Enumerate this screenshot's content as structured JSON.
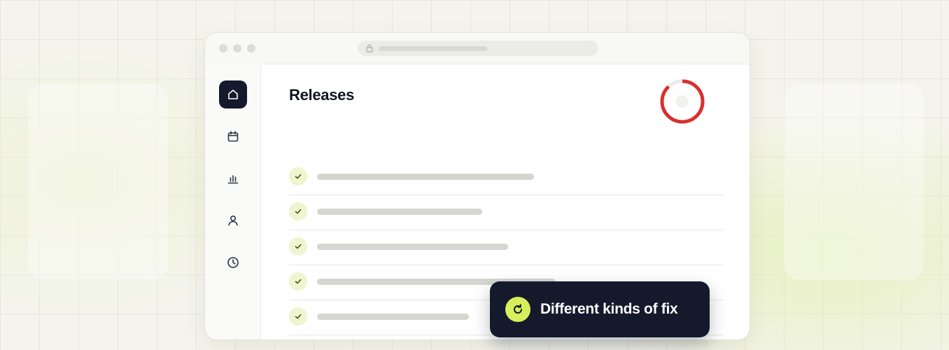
{
  "icons": {
    "lock": "lock-icon",
    "nav": [
      "home-icon",
      "calendar-icon",
      "chart-icon",
      "user-icon",
      "clock-icon"
    ],
    "row_status": "check-icon",
    "toast": "refresh-icon"
  },
  "sidebar": {
    "items": [
      {
        "icon": "home-icon",
        "active": true
      },
      {
        "icon": "calendar-icon",
        "active": false
      },
      {
        "icon": "chart-icon",
        "active": false
      },
      {
        "icon": "user-icon",
        "active": false
      },
      {
        "icon": "clock-icon",
        "active": false
      }
    ]
  },
  "main": {
    "title": "Releases",
    "progress": {
      "fraction": 0.88,
      "color": "#d93030",
      "track_color": "#ececec"
    },
    "releases": [
      {
        "status": "done"
      },
      {
        "status": "done"
      },
      {
        "status": "done"
      },
      {
        "status": "done"
      },
      {
        "status": "done"
      }
    ]
  },
  "toast": {
    "text": "Different kinds of fix"
  },
  "colors": {
    "accent": "#d7ef5c",
    "dark": "#141a2c",
    "check_bg": "#eef5cf",
    "check_mark": "#3d4a12"
  }
}
